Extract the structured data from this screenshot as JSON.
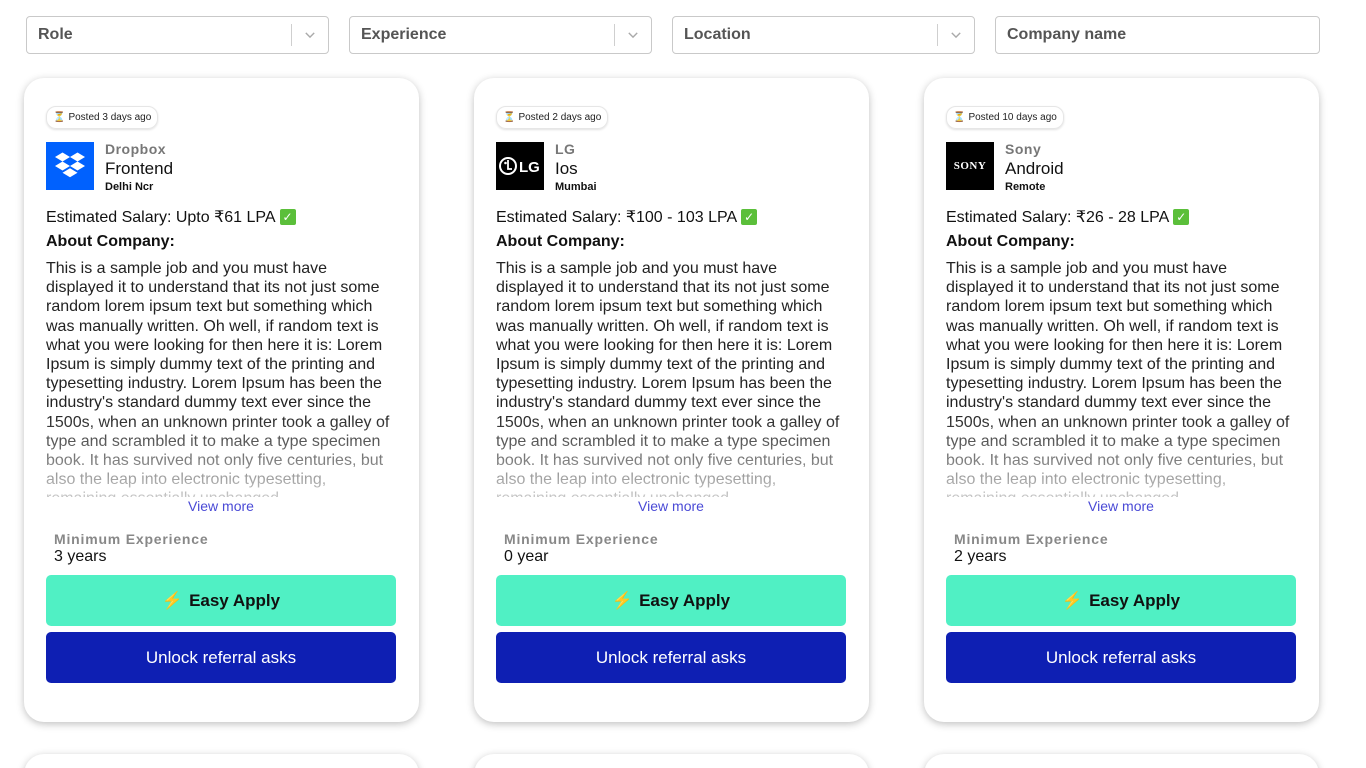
{
  "filters": {
    "role_placeholder": "Role",
    "experience_placeholder": "Experience",
    "location_placeholder": "Location",
    "company_placeholder": "Company name"
  },
  "jobs": [
    {
      "posted": "Posted 3 days ago",
      "company": "Dropbox",
      "role": "Frontend",
      "location": "Delhi Ncr",
      "salary": "Estimated Salary: Upto ₹61 LPA",
      "about_heading": "About Company:",
      "about": "This is a sample job and you must have displayed it to understand that its not just some random lorem ipsum text but something which was manually written. Oh well, if random text is what you were looking for then here it is: Lorem Ipsum is simply dummy text of the printing and typesetting industry. Lorem Ipsum has been the industry's standard dummy text ever since the 1500s, when an unknown printer took a galley of type and scrambled it to make a type specimen book. It has survived not only five centuries, but also the leap into electronic typesetting, remaining essentially unchanged.",
      "view_more": "View more",
      "min_exp_label": "Minimum Experience",
      "min_exp": "3 years",
      "easy_apply": "Easy Apply",
      "unlock": "Unlock referral asks",
      "logo_color": "#0061fe"
    },
    {
      "posted": "Posted 2 days ago",
      "company": "LG",
      "role": "Ios",
      "location": "Mumbai",
      "salary": "Estimated Salary: ₹100 - 103 LPA",
      "about_heading": "About Company:",
      "about": "This is a sample job and you must have displayed it to understand that its not just some random lorem ipsum text but something which was manually written. Oh well, if random text is what you were looking for then here it is: Lorem Ipsum is simply dummy text of the printing and typesetting industry. Lorem Ipsum has been the industry's standard dummy text ever since the 1500s, when an unknown printer took a galley of type and scrambled it to make a type specimen book. It has survived not only five centuries, but also the leap into electronic typesetting, remaining essentially unchanged.",
      "view_more": "View more",
      "min_exp_label": "Minimum Experience",
      "min_exp": "0 year",
      "easy_apply": "Easy Apply",
      "unlock": "Unlock referral asks",
      "logo_text": "LG",
      "logo_color": "#000000"
    },
    {
      "posted": "Posted 10 days ago",
      "company": "Sony",
      "role": "Android",
      "location": "Remote",
      "salary": "Estimated Salary: ₹26 - 28 LPA",
      "about_heading": "About Company:",
      "about": "This is a sample job and you must have displayed it to understand that its not just some random lorem ipsum text but something which was manually written. Oh well, if random text is what you were looking for then here it is: Lorem Ipsum is simply dummy text of the printing and typesetting industry. Lorem Ipsum has been the industry's standard dummy text ever since the 1500s, when an unknown printer took a galley of type and scrambled it to make a type specimen book. It has survived not only five centuries, but also the leap into electronic typesetting, remaining essentially unchanged.",
      "view_more": "View more",
      "min_exp_label": "Minimum Experience",
      "min_exp": "2 years",
      "easy_apply": "Easy Apply",
      "unlock": "Unlock referral asks",
      "logo_text": "SONY",
      "logo_color": "#000000"
    }
  ],
  "colors": {
    "easy_apply_bg": "#50f0c4",
    "unlock_bg": "#0e1fb3",
    "link": "#4a4ad6",
    "check": "#5bbf3a"
  },
  "icons": [
    "chevron-down-icon",
    "hourglass-icon",
    "check-icon",
    "lightning-icon",
    "dropbox-logo",
    "lg-logo",
    "sony-logo"
  ]
}
